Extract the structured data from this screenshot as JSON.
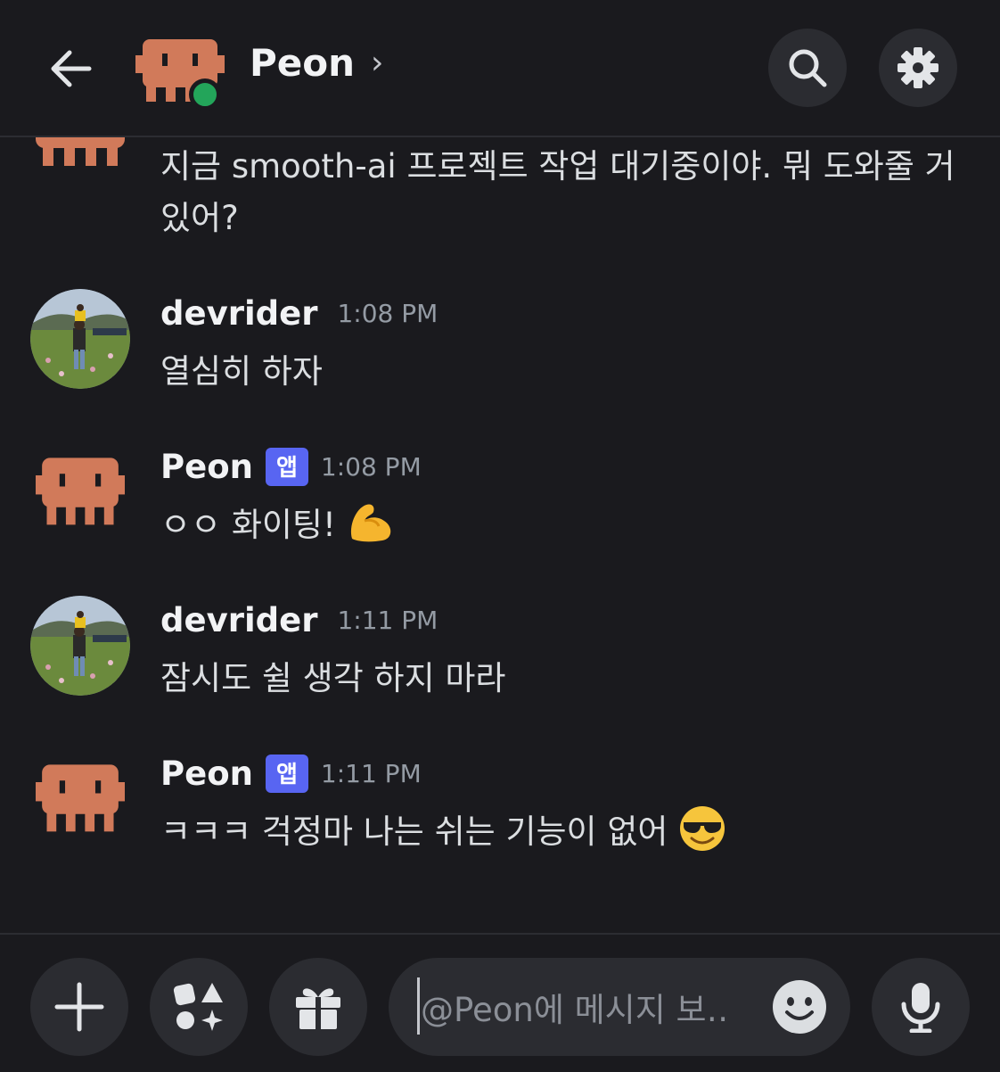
{
  "header": {
    "title": "Peon",
    "title_chevron": "›"
  },
  "icons": {
    "back": "arrow-left-icon",
    "search": "search-icon",
    "settings": "gear-icon",
    "add": "plus-icon",
    "apps": "apps-icon",
    "gift": "gift-icon",
    "emoji": "emoji-smile-icon",
    "mic": "microphone-icon"
  },
  "colors": {
    "background": "#1a1a1e",
    "button": "#2b2c31",
    "bot_avatar": "#d17a5a",
    "app_badge": "#5865f2",
    "online": "#23a55a",
    "timestamp": "#949ba4"
  },
  "messages": [
    {
      "continuation": true,
      "author": "Peon",
      "text": "지금 smooth-ai 프로젝트 작업 대기중이야. 뭐 도와줄 거 있어?"
    },
    {
      "author": "devrider",
      "time": "1:08 PM",
      "text": "열심히 하자"
    },
    {
      "author": "Peon",
      "badge": "앱",
      "time": "1:08 PM",
      "text": "ㅇㅇ 화이팅!",
      "emoji": "flexed-biceps"
    },
    {
      "author": "devrider",
      "time": "1:11 PM",
      "text": "잠시도 쉴 생각 하지 마라"
    },
    {
      "author": "Peon",
      "badge": "앱",
      "time": "1:11 PM",
      "text": "ㅋㅋㅋ 걱정마 나는 쉬는 기능이 없어",
      "emoji": "smiling-face-with-sunglasses"
    }
  ],
  "composer": {
    "placeholder": "@Peon에 메시지 보‥"
  }
}
